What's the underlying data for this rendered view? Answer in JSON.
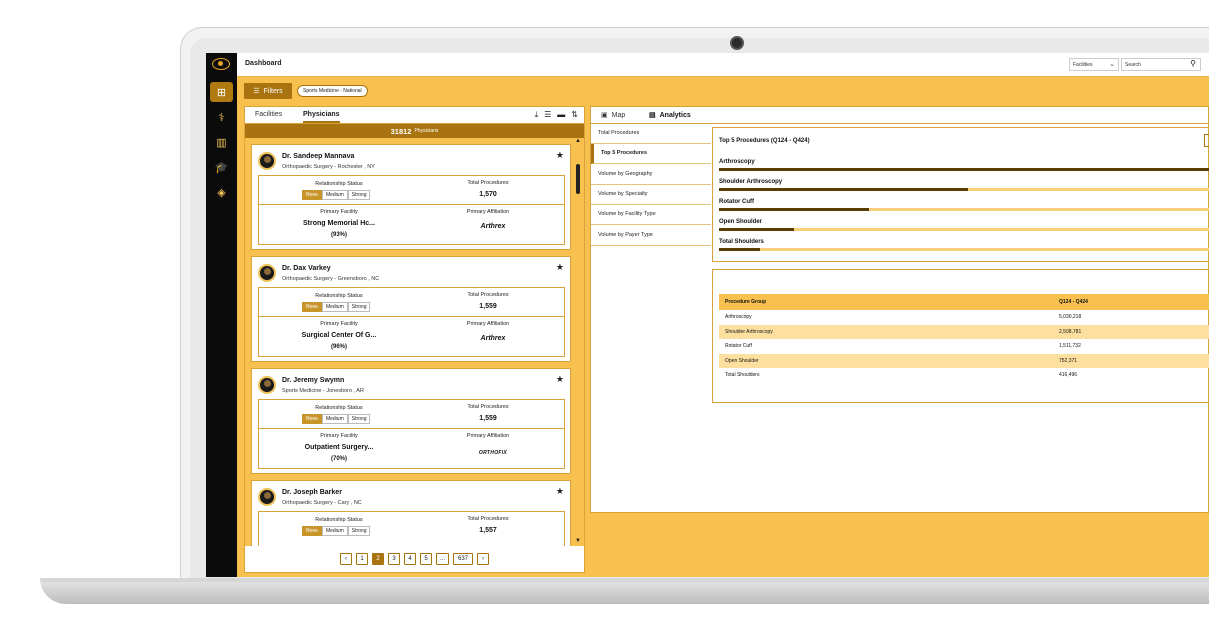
{
  "app": {
    "title": "Dashboard",
    "facility_select": "Facilities",
    "search_placeholder": "Search"
  },
  "rail": {
    "items": [
      {
        "icon": "grid-icon",
        "glyph": "⊞",
        "active": true
      },
      {
        "icon": "stethoscope-icon",
        "glyph": "⚕",
        "active": false
      },
      {
        "icon": "buildings-icon",
        "glyph": "▥",
        "active": false
      },
      {
        "icon": "graduation-cap-icon",
        "glyph": "🎓",
        "active": false
      },
      {
        "icon": "shield-icon",
        "glyph": "◈",
        "active": false
      }
    ]
  },
  "filters": {
    "button_label": "Filters",
    "chip": "Sports Medicine - National"
  },
  "left_panel": {
    "tabs": [
      "Facilities",
      "Physicians"
    ],
    "active_tab": "Physicians",
    "count_value": "31812",
    "count_label": "Physicians",
    "physicians": [
      {
        "name": "Dr. Sandeep Mannava",
        "specialty": "Orthopaedic Surgery - Rochester , NY",
        "relationship_label": "Relationship Status",
        "relationship_options": [
          "None",
          "Medium",
          "Strong"
        ],
        "relationship_selected": "None",
        "total_label": "Total Procedures",
        "total": "1,570",
        "facility_label": "Primary Facility",
        "facility": "Strong Memorial Hc...",
        "facility_pct": "(93%)",
        "affiliation_label": "Primary Affiliation",
        "affiliation": "Arthrex"
      },
      {
        "name": "Dr. Dax Varkey",
        "specialty": "Orthopaedic Surgery - Greensboro , NC",
        "relationship_label": "Relationship Status",
        "relationship_options": [
          "None",
          "Medium",
          "Strong"
        ],
        "relationship_selected": "None",
        "total_label": "Total Procedures",
        "total": "1,559",
        "facility_label": "Primary Facility",
        "facility": "Surgical Center Of G...",
        "facility_pct": "(96%)",
        "affiliation_label": "Primary Affiliation",
        "affiliation": "Arthrex"
      },
      {
        "name": "Dr. Jeremy Swymn",
        "specialty": "Sports Medicine - Jonesboro , AR",
        "relationship_label": "Relationship Status",
        "relationship_options": [
          "None",
          "Medium",
          "Strong"
        ],
        "relationship_selected": "None",
        "total_label": "Total Procedures",
        "total": "1,559",
        "facility_label": "Primary Facility",
        "facility": "Outpatient Surgery...",
        "facility_pct": "(70%)",
        "affiliation_label": "Primary Affiliation",
        "affiliation": "ORTHOFIX"
      },
      {
        "name": "Dr. Joseph Barker",
        "specialty": "Orthopaedic Surgery - Cary , NC",
        "relationship_label": "Relationship Status",
        "relationship_options": [
          "None",
          "Medium",
          "Strong"
        ],
        "relationship_selected": "None",
        "total_label": "Total Procedures",
        "total": "1,557"
      }
    ],
    "pagination": {
      "prev": "‹",
      "pages": [
        "1",
        "2",
        "3",
        "4",
        "5"
      ],
      "current": "2",
      "ellipsis": "...",
      "last": "637",
      "next": "›"
    }
  },
  "right_panel": {
    "tabs": [
      {
        "label": "Map",
        "icon": "map-icon"
      },
      {
        "label": "Analytics",
        "icon": "analytics-icon"
      }
    ],
    "active_tab": "Analytics",
    "side_menu": [
      "Total Procedures",
      "Top 5 Procedures",
      "Volume by Geography",
      "Volume by Specialty",
      "Volume by Facility Type",
      "Volume by Payer Type"
    ],
    "active_menu": "Top 5 Procedures",
    "chart_data": {
      "type": "bar",
      "title": "Top 5 Procedures (Q124 - Q424)",
      "categories": [
        "Arthroscopy",
        "Shoulder Arthroscopy",
        "Rotator Cuff",
        "Open Shoulder",
        "Total Shoulders"
      ],
      "values": [
        5030218,
        2508781,
        1511732,
        752371,
        416496
      ],
      "xlim": [
        0,
        5030218
      ]
    },
    "table": {
      "headers": [
        "Procedure Group",
        "Q124 - Q424"
      ],
      "rows": [
        [
          "Arthroscopy",
          "5,030,218"
        ],
        [
          "Shoulder Arthroscopy",
          "2,508,781"
        ],
        [
          "Rotator Cuff",
          "1,511,732"
        ],
        [
          "Open Shoulder",
          "752,371"
        ],
        [
          "Total Shoulders",
          "416,496"
        ]
      ]
    }
  },
  "colors": {
    "accent": "#f8c04f",
    "dark_accent": "#a97410",
    "bar": "#5a3d05",
    "rail": "#0b0b0b"
  }
}
